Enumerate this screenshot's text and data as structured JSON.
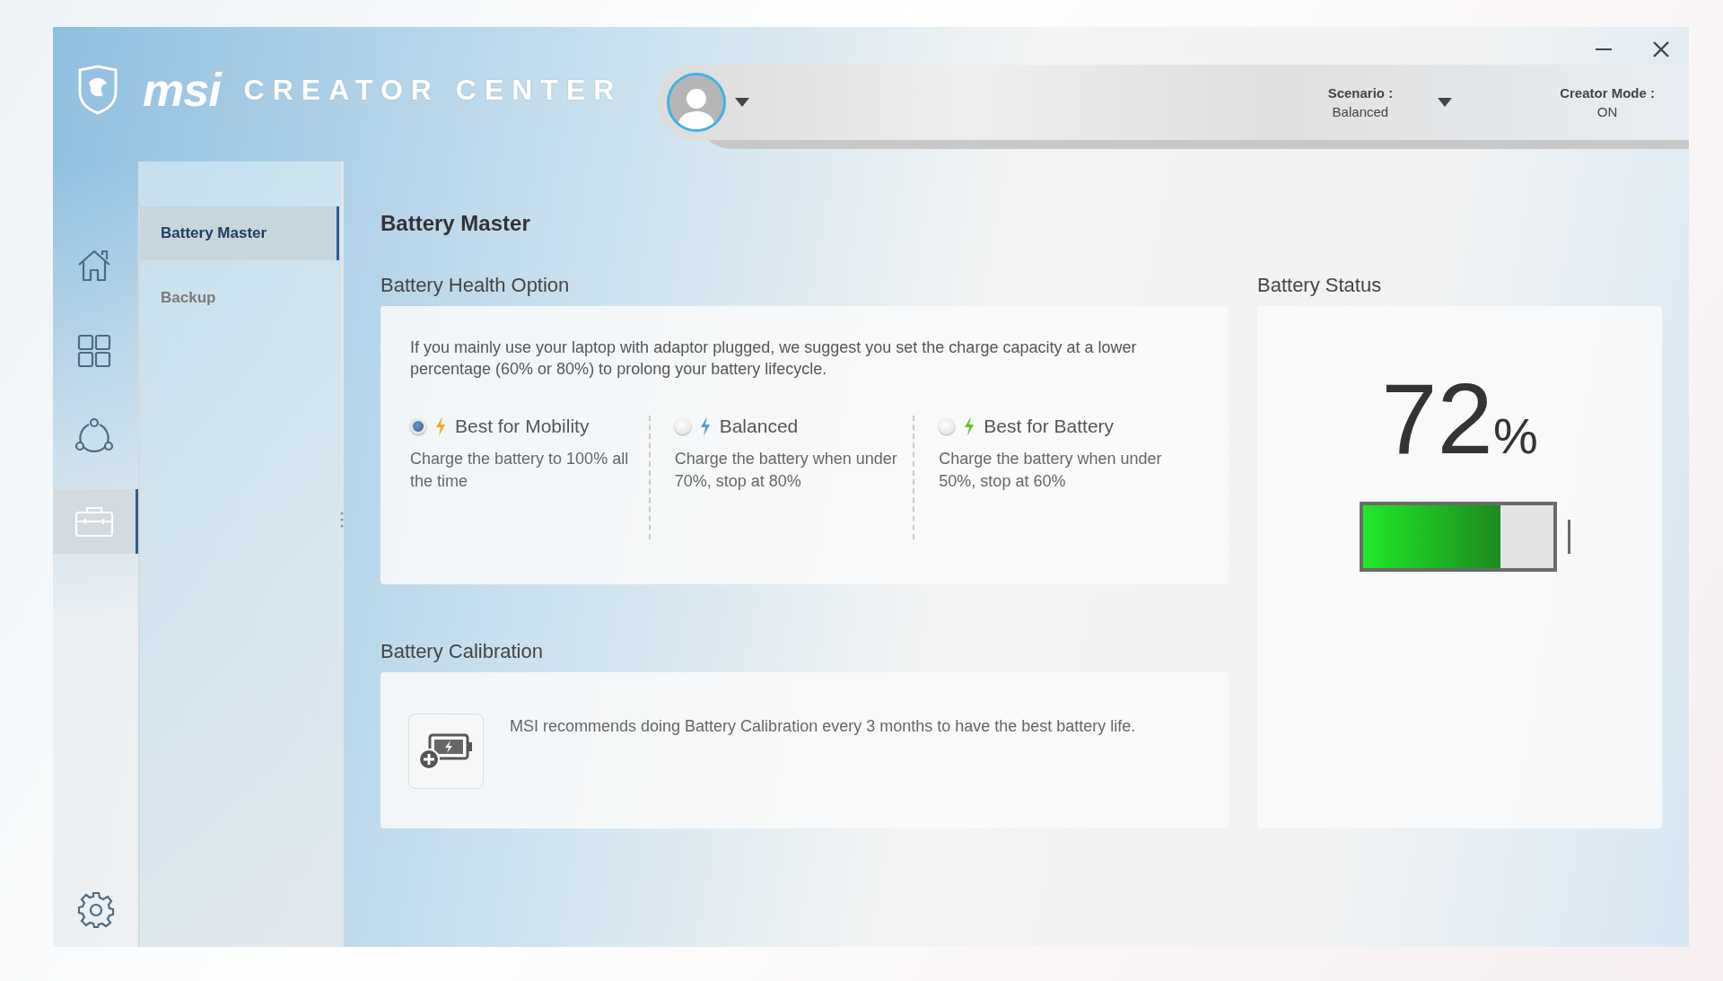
{
  "logo": {
    "brand": "msi",
    "product": "CREATOR CENTER"
  },
  "header": {
    "scenario": {
      "label": "Scenario :",
      "value": "Balanced"
    },
    "creator_mode": {
      "label": "Creator Mode :",
      "value": "ON"
    }
  },
  "nav_rail": [
    {
      "kind": "home",
      "selected": false
    },
    {
      "kind": "grid",
      "selected": false
    },
    {
      "kind": "share",
      "selected": false
    },
    {
      "kind": "toolbox",
      "selected": true
    }
  ],
  "submenu": [
    {
      "label": "Battery Master",
      "selected": true
    },
    {
      "label": "Backup",
      "selected": false
    }
  ],
  "page_title": "Battery Master",
  "health_option": {
    "heading": "Battery Health Option",
    "description": "If you mainly use your laptop with adaptor plugged, we suggest you set the charge capacity at a lower percentage (60% or 80%) to prolong your battery lifecycle.",
    "options": [
      {
        "label": "Best for Mobility",
        "description": "Charge the battery to 100% all the time",
        "selected": true,
        "color": "#f5a623"
      },
      {
        "label": "Balanced",
        "description": "Charge the battery when under 70%, stop at 80%",
        "selected": false,
        "color": "#5b9bd5"
      },
      {
        "label": "Best for Battery",
        "description": "Charge the battery when under 50%, stop at 60%",
        "selected": false,
        "color": "#5fc82a"
      }
    ]
  },
  "calibration": {
    "heading": "Battery Calibration",
    "text": "MSI recommends doing Battery Calibration every 3 months to have the best battery life."
  },
  "battery_status": {
    "heading": "Battery Status",
    "value": "72",
    "unit": "%",
    "level": 0.72
  }
}
